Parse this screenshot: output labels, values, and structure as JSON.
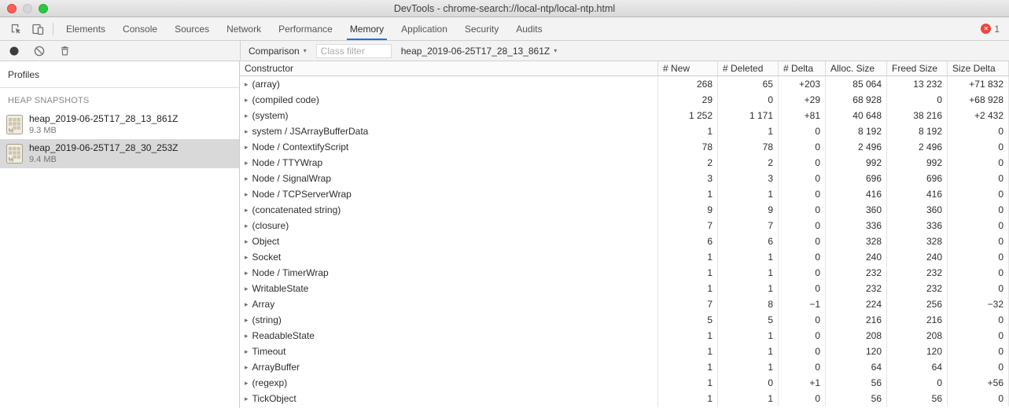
{
  "window": {
    "title": "DevTools - chrome-search://local-ntp/local-ntp.html"
  },
  "tabbar": {
    "tabs": [
      "Elements",
      "Console",
      "Sources",
      "Network",
      "Performance",
      "Memory",
      "Application",
      "Security",
      "Audits"
    ],
    "selected_tab": "Memory",
    "error_count": "1"
  },
  "toolbar": {
    "comparison_label": "Comparison",
    "class_filter_placeholder": "Class filter",
    "base_snapshot": "heap_2019-06-25T17_28_13_861Z"
  },
  "sidebar": {
    "header": "Profiles",
    "section_title": "HEAP SNAPSHOTS",
    "snapshots": [
      {
        "name": "heap_2019-06-25T17_28_13_861Z",
        "size": "9.3 MB",
        "selected": false
      },
      {
        "name": "heap_2019-06-25T17_28_30_253Z",
        "size": "9.4 MB",
        "selected": true
      }
    ]
  },
  "table": {
    "columns": [
      "Constructor",
      "# New",
      "# Deleted",
      "# Delta",
      "Alloc. Size",
      "Freed Size",
      "Size Delta"
    ],
    "rows": [
      {
        "name": "(array)",
        "values": [
          "268",
          "65",
          "+203",
          "85 064",
          "13 232",
          "+71 832"
        ]
      },
      {
        "name": "(compiled code)",
        "values": [
          "29",
          "0",
          "+29",
          "68 928",
          "0",
          "+68 928"
        ]
      },
      {
        "name": "(system)",
        "values": [
          "1 252",
          "1 171",
          "+81",
          "40 648",
          "38 216",
          "+2 432"
        ]
      },
      {
        "name": "system / JSArrayBufferData",
        "values": [
          "1",
          "1",
          "0",
          "8 192",
          "8 192",
          "0"
        ]
      },
      {
        "name": "Node / ContextifyScript",
        "values": [
          "78",
          "78",
          "0",
          "2 496",
          "2 496",
          "0"
        ]
      },
      {
        "name": "Node / TTYWrap",
        "values": [
          "2",
          "2",
          "0",
          "992",
          "992",
          "0"
        ]
      },
      {
        "name": "Node / SignalWrap",
        "values": [
          "3",
          "3",
          "0",
          "696",
          "696",
          "0"
        ]
      },
      {
        "name": "Node / TCPServerWrap",
        "values": [
          "1",
          "1",
          "0",
          "416",
          "416",
          "0"
        ]
      },
      {
        "name": "(concatenated string)",
        "values": [
          "9",
          "9",
          "0",
          "360",
          "360",
          "0"
        ]
      },
      {
        "name": "(closure)",
        "values": [
          "7",
          "7",
          "0",
          "336",
          "336",
          "0"
        ]
      },
      {
        "name": "Object",
        "values": [
          "6",
          "6",
          "0",
          "328",
          "328",
          "0"
        ]
      },
      {
        "name": "Socket",
        "values": [
          "1",
          "1",
          "0",
          "240",
          "240",
          "0"
        ]
      },
      {
        "name": "Node / TimerWrap",
        "values": [
          "1",
          "1",
          "0",
          "232",
          "232",
          "0"
        ]
      },
      {
        "name": "WritableState",
        "values": [
          "1",
          "1",
          "0",
          "232",
          "232",
          "0"
        ]
      },
      {
        "name": "Array",
        "values": [
          "7",
          "8",
          "−1",
          "224",
          "256",
          "−32"
        ]
      },
      {
        "name": "(string)",
        "values": [
          "5",
          "5",
          "0",
          "216",
          "216",
          "0"
        ]
      },
      {
        "name": "ReadableState",
        "values": [
          "1",
          "1",
          "0",
          "208",
          "208",
          "0"
        ]
      },
      {
        "name": "Timeout",
        "values": [
          "1",
          "1",
          "0",
          "120",
          "120",
          "0"
        ]
      },
      {
        "name": "ArrayBuffer",
        "values": [
          "1",
          "1",
          "0",
          "64",
          "64",
          "0"
        ]
      },
      {
        "name": "(regexp)",
        "values": [
          "1",
          "0",
          "+1",
          "56",
          "0",
          "+56"
        ]
      },
      {
        "name": "TickObject",
        "values": [
          "1",
          "1",
          "0",
          "56",
          "56",
          "0"
        ]
      }
    ]
  },
  "icons": {
    "expand_arrow": "▸",
    "dropdown_arrow": "▾",
    "error_x": "✕"
  },
  "colors": {
    "accent_blue": "#1a73e8",
    "error_red": "#e9483f",
    "toolbar_bg": "#f3f3f3",
    "selection_gray": "#d9d9d9"
  }
}
